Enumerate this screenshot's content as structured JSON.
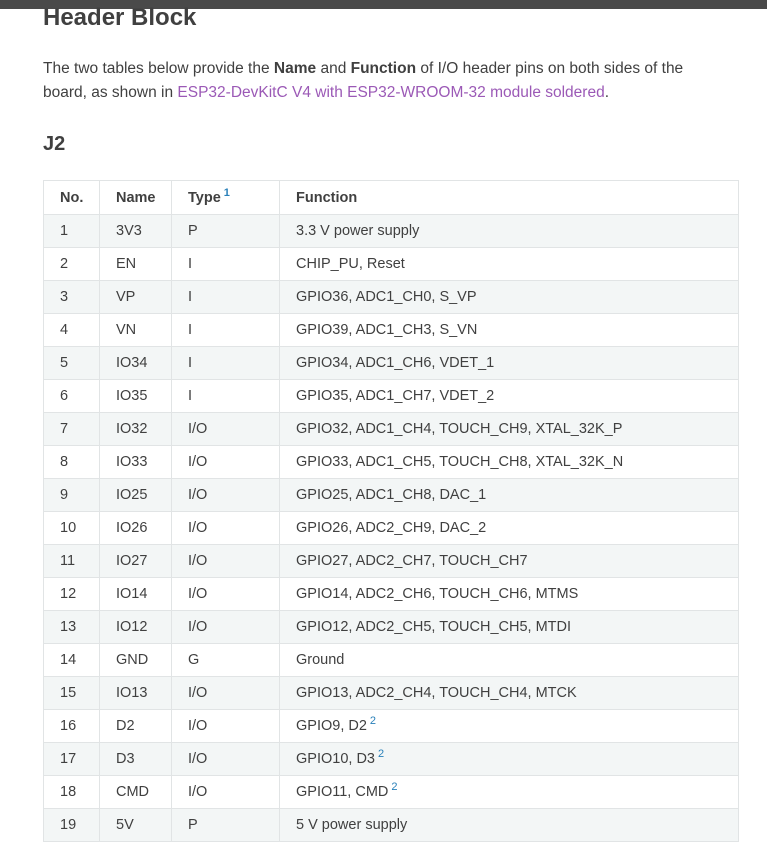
{
  "header": {
    "title": "Header Block"
  },
  "intro": {
    "t1": "The two tables below provide the ",
    "b1": "Name",
    "t2": " and ",
    "b2": "Function",
    "t3": " of I/O header pins on both sides of the board, as shown in ",
    "link": "ESP32-DevKitC V4 with ESP32-WROOM-32 module soldered",
    "t4": "."
  },
  "section": {
    "title": "J2"
  },
  "table": {
    "headers": [
      "No.",
      "Name",
      "Type",
      "Function"
    ],
    "type_footnote": "1",
    "rows": [
      {
        "no": "1",
        "name": "3V3",
        "type": "P",
        "func": "3.3 V power supply",
        "fn": ""
      },
      {
        "no": "2",
        "name": "EN",
        "type": "I",
        "func": "CHIP_PU, Reset",
        "fn": ""
      },
      {
        "no": "3",
        "name": "VP",
        "type": "I",
        "func": "GPIO36, ADC1_CH0, S_VP",
        "fn": ""
      },
      {
        "no": "4",
        "name": "VN",
        "type": "I",
        "func": "GPIO39, ADC1_CH3, S_VN",
        "fn": ""
      },
      {
        "no": "5",
        "name": "IO34",
        "type": "I",
        "func": "GPIO34, ADC1_CH6, VDET_1",
        "fn": ""
      },
      {
        "no": "6",
        "name": "IO35",
        "type": "I",
        "func": "GPIO35, ADC1_CH7, VDET_2",
        "fn": ""
      },
      {
        "no": "7",
        "name": "IO32",
        "type": "I/O",
        "func": "GPIO32, ADC1_CH4, TOUCH_CH9, XTAL_32K_P",
        "fn": ""
      },
      {
        "no": "8",
        "name": "IO33",
        "type": "I/O",
        "func": "GPIO33, ADC1_CH5, TOUCH_CH8, XTAL_32K_N",
        "fn": ""
      },
      {
        "no": "9",
        "name": "IO25",
        "type": "I/O",
        "func": "GPIO25, ADC1_CH8, DAC_1",
        "fn": ""
      },
      {
        "no": "10",
        "name": "IO26",
        "type": "I/O",
        "func": "GPIO26, ADC2_CH9, DAC_2",
        "fn": ""
      },
      {
        "no": "11",
        "name": "IO27",
        "type": "I/O",
        "func": "GPIO27, ADC2_CH7, TOUCH_CH7",
        "fn": ""
      },
      {
        "no": "12",
        "name": "IO14",
        "type": "I/O",
        "func": "GPIO14, ADC2_CH6, TOUCH_CH6, MTMS",
        "fn": ""
      },
      {
        "no": "13",
        "name": "IO12",
        "type": "I/O",
        "func": "GPIO12, ADC2_CH5, TOUCH_CH5, MTDI",
        "fn": ""
      },
      {
        "no": "14",
        "name": "GND",
        "type": "G",
        "func": "Ground",
        "fn": ""
      },
      {
        "no": "15",
        "name": "IO13",
        "type": "I/O",
        "func": "GPIO13, ADC2_CH4, TOUCH_CH4, MTCK",
        "fn": ""
      },
      {
        "no": "16",
        "name": "D2",
        "type": "I/O",
        "func": "GPIO9, D2",
        "fn": "2"
      },
      {
        "no": "17",
        "name": "D3",
        "type": "I/O",
        "func": "GPIO10, D3",
        "fn": "2"
      },
      {
        "no": "18",
        "name": "CMD",
        "type": "I/O",
        "func": "GPIO11, CMD",
        "fn": "2"
      },
      {
        "no": "19",
        "name": "5V",
        "type": "P",
        "func": "5 V power supply",
        "fn": ""
      }
    ]
  },
  "colors": {
    "link": "#9b59b6",
    "footnote": "#2980b9",
    "text": "#404040",
    "stripe": "#f3f6f6"
  }
}
